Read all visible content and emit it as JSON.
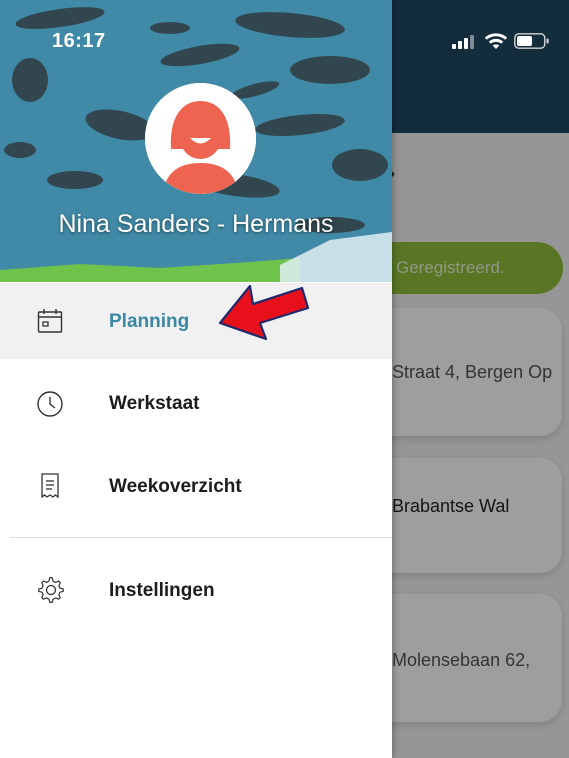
{
  "status_bar": {
    "time": "16:17"
  },
  "drawer": {
    "user_name": "Nina Sanders - Hermans",
    "menu": {
      "items": [
        {
          "label": "Planning",
          "icon": "calendar-icon",
          "active": true
        },
        {
          "label": "Werkstaat",
          "icon": "clock-icon",
          "active": false
        },
        {
          "label": "Weekoverzicht",
          "icon": "receipt-icon",
          "active": false
        },
        {
          "label": "Instellingen",
          "icon": "gear-icon",
          "active": false
        }
      ]
    }
  },
  "background": {
    "banner_text": "Geregistreerd.",
    "cards": [
      {
        "text": "Straat 4, Bergen Op"
      },
      {
        "text": "Brabantse Wal"
      },
      {
        "text": "Molensebaan 62,"
      }
    ]
  },
  "colors": {
    "header_dark": "#214a63",
    "active_menu_text": "#3b87a6",
    "banner_green": "#8fbf3a",
    "annotation_arrow": "#e8111b"
  }
}
